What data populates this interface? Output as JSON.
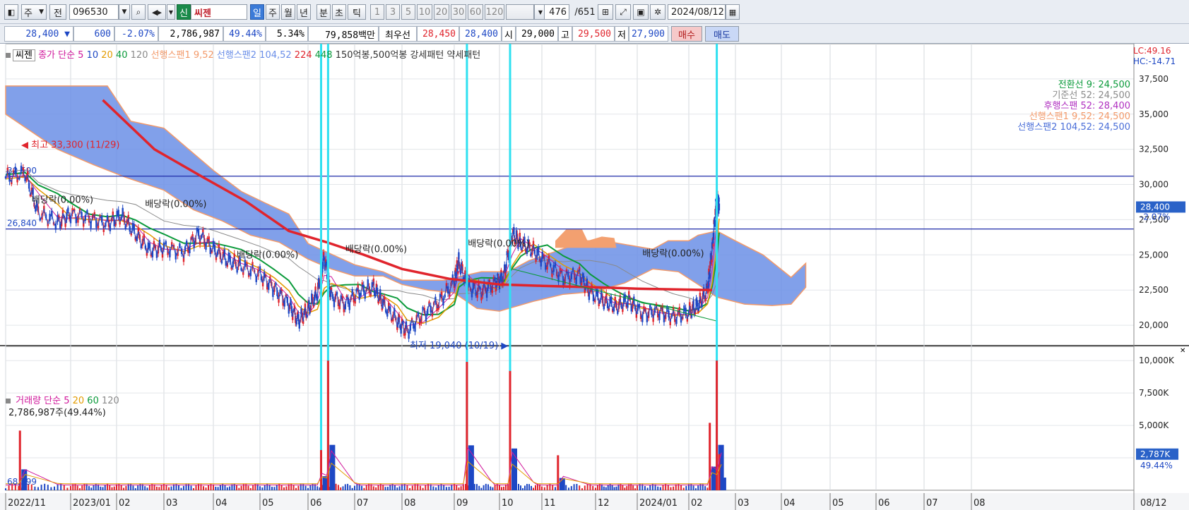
{
  "toolbar": {
    "market_label": "주",
    "prev_label": "전",
    "code": "096530",
    "new_label": "신",
    "stock_name": "씨젠",
    "periods": [
      "일",
      "주",
      "월",
      "년",
      "분",
      "초",
      "틱"
    ],
    "minute_values": [
      "1",
      "3",
      "5",
      "10",
      "20",
      "30",
      "60",
      "120"
    ],
    "count": "476",
    "total": "/651",
    "date": "2024/08/12"
  },
  "quote": {
    "price": "28,400 ▼",
    "change": "600",
    "change_pct": "-2.07%",
    "volume": "2,786,987",
    "volume_ratio": "49.44%",
    "turnover": "5.34%",
    "amount": "79,858백만",
    "best_label": "최우선",
    "ask": "28,450",
    "bid": "28,400",
    "open_label": "시",
    "open": "29,000",
    "high_label": "고",
    "high": "29,500",
    "low_label": "저",
    "low": "27,900",
    "buy_label": "매수",
    "sell_label": "매도"
  },
  "price_panel": {
    "title": "씨젠",
    "legend": [
      {
        "text": "종가 단순 5",
        "color": "#d0179b"
      },
      {
        "text": "10",
        "color": "#1d47c4"
      },
      {
        "text": "20",
        "color": "#e39b00"
      },
      {
        "text": "40",
        "color": "#0a9a3a"
      },
      {
        "text": "120",
        "color": "#8a8a8a"
      },
      {
        "text": "선행스팬1 9,52",
        "color": "#f39a6a"
      },
      {
        "text": "선행스팬2 104,52",
        "color": "#6a8ee8"
      },
      {
        "text": "224",
        "color": "#e0242c"
      },
      {
        "text": "448",
        "color": "#0a9a3a"
      },
      {
        "text": "150억봉,500억봉 강세패턴",
        "color": "#333333"
      },
      {
        "text": "약세패턴",
        "color": "#333333"
      }
    ],
    "lc": "LC:49.16",
    "hc": "HC:-14.71",
    "ichimoku": [
      {
        "text": "전환선 9: 24,500",
        "color": "#0a9a3a"
      },
      {
        "text": "기준선 52: 24,500",
        "color": "#8a8a8a"
      },
      {
        "text": "후행스팬 52: 28,400",
        "color": "#b030c0"
      },
      {
        "text": "선행스팬1 9,52: 24,500",
        "color": "#f39a6a"
      },
      {
        "text": "선행스팬2 104,52: 24,500",
        "color": "#4a6ed8"
      }
    ],
    "yticks": [
      "37,500",
      "35,000",
      "32,500",
      "30,000",
      "27,500",
      "25,000",
      "22,500",
      "20,000"
    ],
    "current_price": "28,400",
    "current_pct": "-2.07%",
    "high_annot": "최고 33,300 (11/29)",
    "low_annot": "최저 19,040 (10/19)",
    "level1": "30,590",
    "level2": "26,840",
    "dividend": "배당락(0.00%)"
  },
  "volume_panel": {
    "legend": [
      {
        "text": "거래량 단순 5",
        "color": "#d0179b"
      },
      {
        "text": "20",
        "color": "#e39b00"
      },
      {
        "text": "60",
        "color": "#0a9a3a"
      },
      {
        "text": "120",
        "color": "#8a8a8a"
      }
    ],
    "info": "2,786,987주(49.44%)",
    "yticks": [
      "10,000K",
      "7,500K",
      "5,000K"
    ],
    "current": "2,787K",
    "current_pct": "49.44%",
    "left_value": "68,399"
  },
  "xaxis": [
    "2022/11",
    "2023/01",
    "02",
    "03",
    "04",
    "05",
    "06",
    "07",
    "08",
    "09",
    "10",
    "11",
    "12",
    "2024/01",
    "02",
    "03",
    "04",
    "05",
    "06",
    "07",
    "08"
  ],
  "xaxis_end": "08/12",
  "chart_data": {
    "type": "candlestick",
    "title": "씨젠",
    "y_range": [
      18500,
      39500
    ],
    "volume_range": [
      0,
      10500
    ],
    "months": [
      "2022/11",
      "2023/01",
      "02",
      "03",
      "04",
      "05",
      "06",
      "07",
      "08",
      "09",
      "10",
      "11",
      "12",
      "2024/01",
      "02",
      "03",
      "04",
      "05",
      "06",
      "07",
      "08"
    ],
    "close_path": [
      [
        0,
        30500
      ],
      [
        0.3,
        30800
      ],
      [
        0.5,
        28000
      ],
      [
        0.8,
        27300
      ],
      [
        1.0,
        27900
      ],
      [
        1.4,
        27600
      ],
      [
        1.8,
        27200
      ],
      [
        2.1,
        27800
      ],
      [
        2.4,
        26500
      ],
      [
        2.7,
        25300
      ],
      [
        3.0,
        25500
      ],
      [
        3.4,
        25200
      ],
      [
        3.7,
        26500
      ],
      [
        4.0,
        25400
      ],
      [
        4.3,
        24600
      ],
      [
        4.6,
        24200
      ],
      [
        5.0,
        23600
      ],
      [
        5.3,
        22600
      ],
      [
        5.6,
        21500
      ],
      [
        5.8,
        20300
      ],
      [
        6.0,
        21100
      ],
      [
        6.2,
        22300
      ],
      [
        6.35,
        24800
      ],
      [
        6.5,
        22100
      ],
      [
        6.8,
        21500
      ],
      [
        7.1,
        22400
      ],
      [
        7.4,
        22700
      ],
      [
        7.6,
        21500
      ],
      [
        7.9,
        20300
      ],
      [
        8.1,
        19600
      ],
      [
        8.4,
        20800
      ],
      [
        8.7,
        21600
      ],
      [
        9.0,
        23100
      ],
      [
        9.1,
        24500
      ],
      [
        9.3,
        22700
      ],
      [
        9.6,
        22400
      ],
      [
        9.9,
        23000
      ],
      [
        10.1,
        23500
      ],
      [
        10.3,
        26500
      ],
      [
        10.5,
        25800
      ],
      [
        10.8,
        25300
      ],
      [
        11.1,
        24400
      ],
      [
        11.4,
        23400
      ],
      [
        11.7,
        23600
      ],
      [
        11.9,
        22300
      ],
      [
        12.2,
        21700
      ],
      [
        12.5,
        21300
      ],
      [
        12.8,
        21800
      ],
      [
        13.1,
        20800
      ],
      [
        13.4,
        21000
      ],
      [
        13.7,
        20600
      ],
      [
        14.0,
        20900
      ],
      [
        14.2,
        21400
      ],
      [
        14.4,
        22500
      ],
      [
        14.5,
        25400
      ],
      [
        14.6,
        29200
      ],
      [
        14.65,
        28400
      ]
    ],
    "ma224_path": [
      [
        1.7,
        36000
      ],
      [
        2.8,
        32500
      ],
      [
        3.8,
        30500
      ],
      [
        4.7,
        28800
      ],
      [
        5.6,
        26700
      ],
      [
        6.4,
        25900
      ],
      [
        7.2,
        25000
      ],
      [
        8.0,
        24000
      ],
      [
        8.9,
        23300
      ],
      [
        10.0,
        22900
      ],
      [
        11.0,
        22800
      ],
      [
        12.0,
        22700
      ],
      [
        13.0,
        22600
      ],
      [
        14.5,
        22500
      ]
    ],
    "cloud_upper": [
      [
        0,
        37000
      ],
      [
        1.8,
        37000
      ],
      [
        2.3,
        34500
      ],
      [
        3.0,
        34000
      ],
      [
        3.5,
        32500
      ],
      [
        4.0,
        31000
      ],
      [
        4.6,
        29500
      ],
      [
        5.1,
        28700
      ],
      [
        5.6,
        27900
      ],
      [
        6.0,
        25800
      ],
      [
        6.4,
        25200
      ],
      [
        7.0,
        24300
      ],
      [
        7.6,
        23800
      ],
      [
        8.0,
        23200
      ],
      [
        8.8,
        23200
      ],
      [
        9.6,
        23800
      ],
      [
        10.2,
        23800
      ],
      [
        10.7,
        24600
      ],
      [
        11.3,
        25300
      ],
      [
        11.8,
        26000
      ],
      [
        12.2,
        26000
      ],
      [
        13.3,
        25400
      ],
      [
        13.6,
        26000
      ],
      [
        14.0,
        26000
      ],
      [
        14.2,
        26400
      ],
      [
        14.6,
        26700
      ],
      [
        15.0,
        26000
      ],
      [
        15.6,
        25000
      ],
      [
        16.2,
        23400
      ],
      [
        16.5,
        24400
      ]
    ],
    "cloud_lower": [
      [
        0,
        35000
      ],
      [
        0.8,
        32500
      ],
      [
        1.5,
        31400
      ],
      [
        2.2,
        30500
      ],
      [
        3.0,
        29600
      ],
      [
        3.6,
        28200
      ],
      [
        4.2,
        27400
      ],
      [
        4.8,
        26400
      ],
      [
        5.4,
        25900
      ],
      [
        6.0,
        24700
      ],
      [
        6.5,
        24000
      ],
      [
        7.0,
        23500
      ],
      [
        7.6,
        23500
      ],
      [
        8.0,
        22900
      ],
      [
        8.5,
        22500
      ],
      [
        9.0,
        22300
      ],
      [
        9.5,
        21200
      ],
      [
        10.0,
        21000
      ],
      [
        10.8,
        21700
      ],
      [
        11.4,
        22200
      ],
      [
        12.0,
        22400
      ],
      [
        12.7,
        23000
      ],
      [
        13.3,
        24000
      ],
      [
        13.8,
        23800
      ],
      [
        14.2,
        22900
      ],
      [
        14.6,
        22000
      ],
      [
        15.2,
        21500
      ],
      [
        15.8,
        21400
      ],
      [
        16.2,
        21500
      ],
      [
        16.5,
        22700
      ]
    ],
    "resistance_levels": [
      30590,
      26840
    ],
    "signal_months": [
      6.28,
      6.43,
      9.28,
      10.25,
      14.6
    ],
    "volume_spikes": [
      {
        "x": 0.22,
        "v": 4600
      },
      {
        "x": 6.28,
        "v": 3100
      },
      {
        "x": 6.43,
        "v": 10000
      },
      {
        "x": 9.28,
        "v": 9900
      },
      {
        "x": 10.25,
        "v": 9200
      },
      {
        "x": 11.3,
        "v": 2700
      },
      {
        "x": 14.45,
        "v": 5200
      },
      {
        "x": 14.6,
        "v": 10000
      },
      {
        "x": 14.65,
        "v": 2787
      }
    ]
  }
}
